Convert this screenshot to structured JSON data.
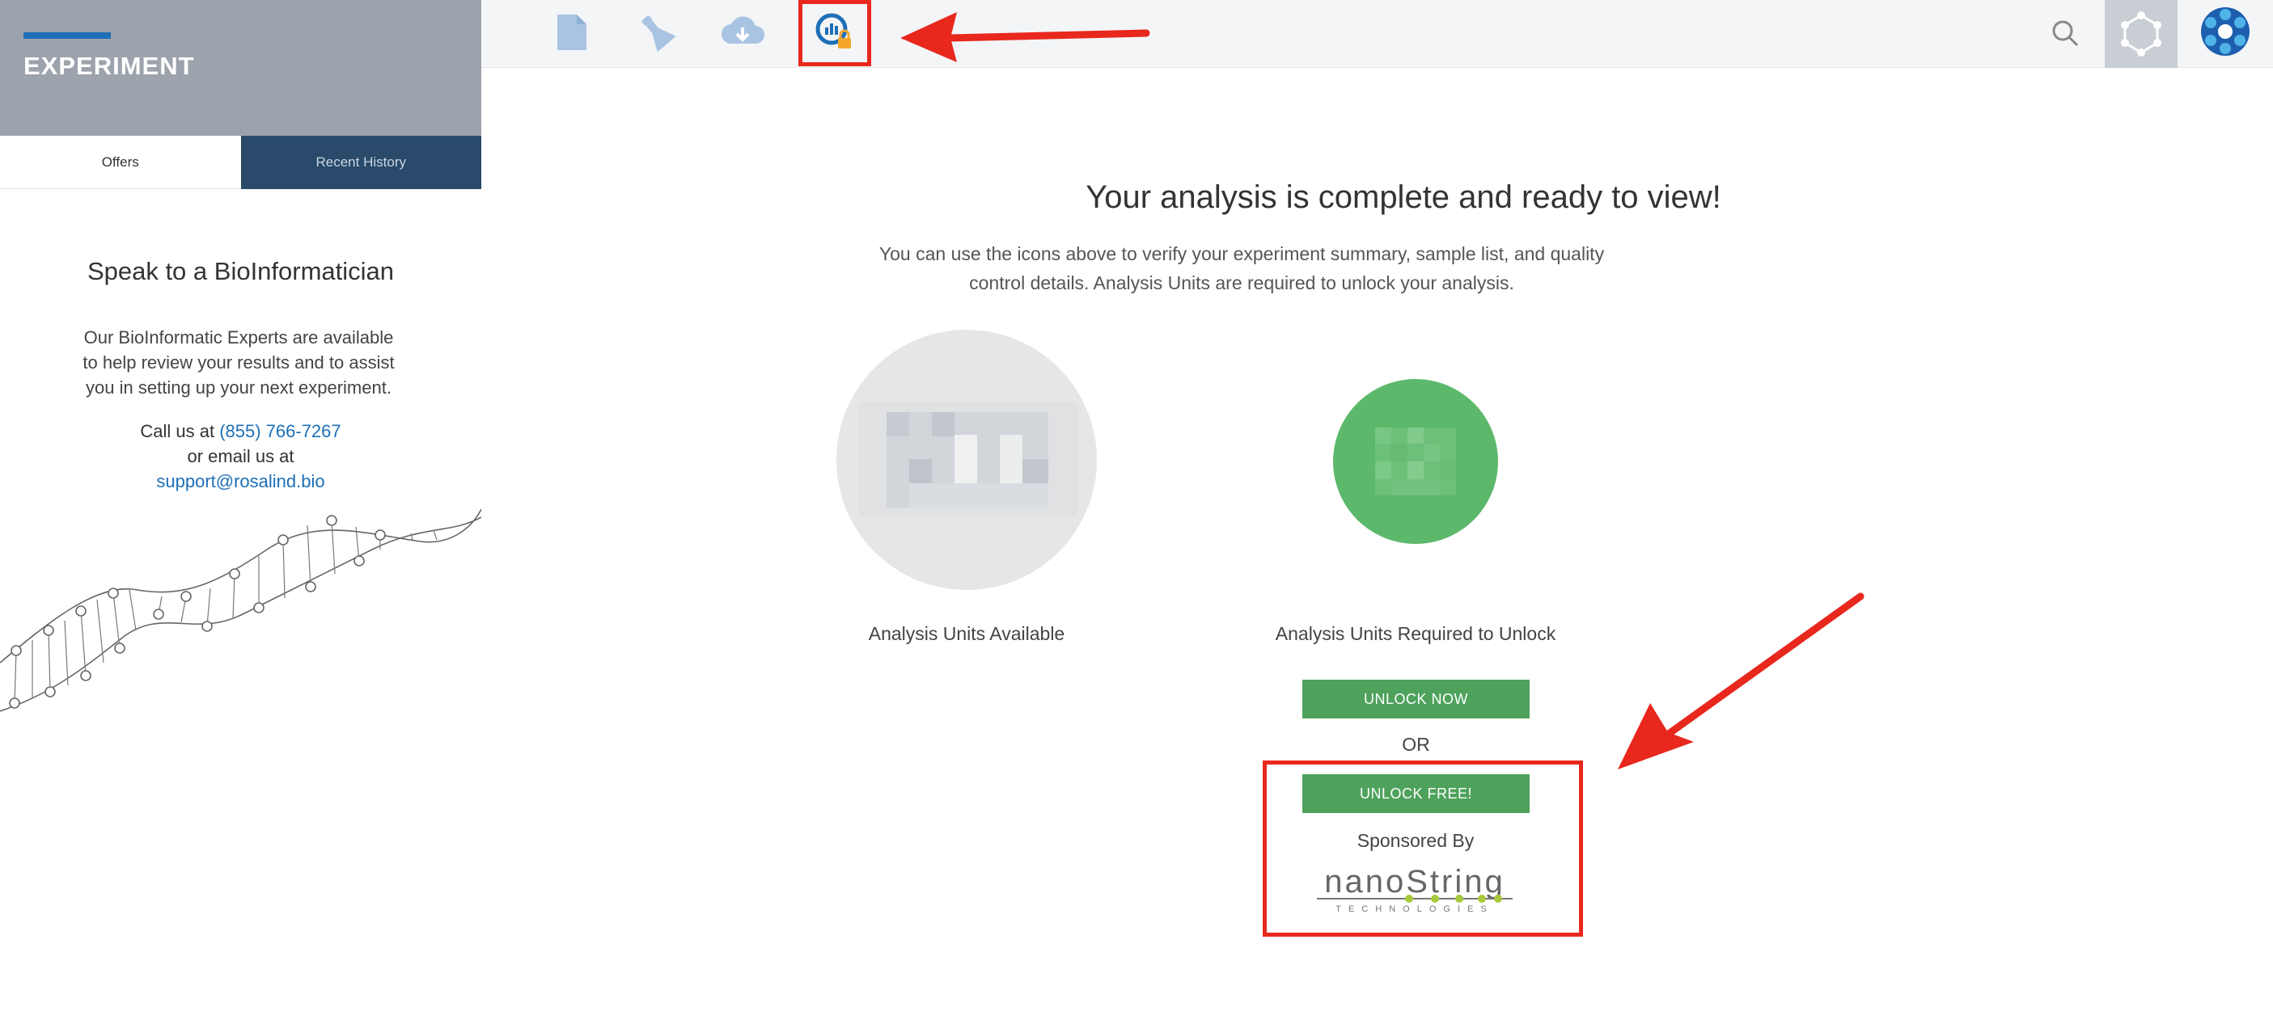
{
  "sidebar": {
    "title": "EXPERIMENT",
    "tabs": [
      {
        "label": "Offers",
        "active": true
      },
      {
        "label": "Recent History",
        "active": false
      }
    ],
    "speak_heading": "Speak to a BioInformatician",
    "body": "Our BioInformatic Experts are available to help review your results and to assist you in setting up your next experiment.",
    "call_prefix": "Call us at",
    "phone": "(855) 766-7267",
    "email_prefix": "or email us at",
    "email": "support@rosalind.bio"
  },
  "topbar": {
    "icons": [
      "document-icon",
      "flask-icon",
      "cloud-download-icon",
      "analysis-locked-icon"
    ],
    "right_icons": [
      "search-icon",
      "settings-icon",
      "brand-logo-icon"
    ]
  },
  "main": {
    "title": "Your analysis is complete and ready to view!",
    "description": "You can use the icons above to verify your experiment summary, sample list, and quality control details. Analysis Units are required to unlock your analysis.",
    "available_label": "Analysis Units Available",
    "required_label": "Analysis Units Required to Unlock",
    "unlock_now_label": "UNLOCK NOW",
    "or_label": "OR",
    "unlock_free_label": "UNLOCK FREE!",
    "sponsored_label": "Sponsored By",
    "sponsor_name": "nanoString",
    "sponsor_sub": "TECHNOLOGIES"
  },
  "colors": {
    "accent": "#1d6fb8",
    "button_green": "#4ea25c",
    "annotation_red": "#e8271d",
    "sidebar_header": "#9da3ac",
    "tab_dark": "#294a6a"
  }
}
